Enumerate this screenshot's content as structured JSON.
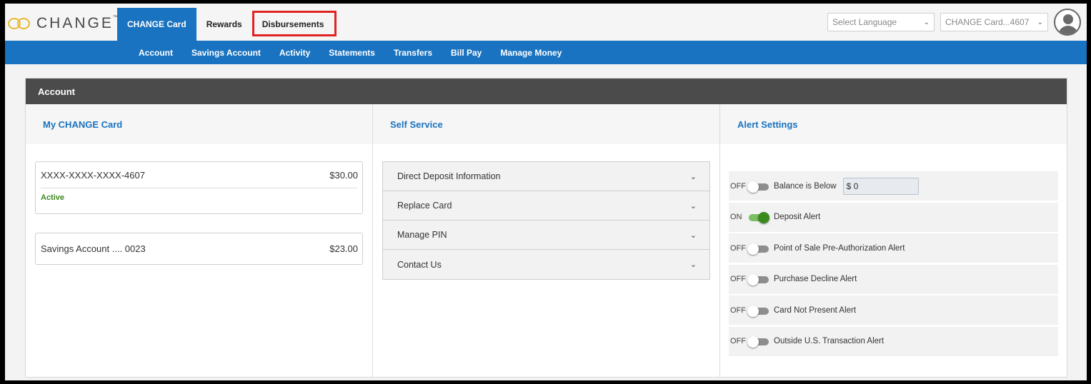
{
  "logo": {
    "text": "CHANGE",
    "tm": "™"
  },
  "main_tabs": [
    {
      "label": "CHANGE Card",
      "active": true
    },
    {
      "label": "Rewards",
      "active": false
    },
    {
      "label": "Disbursements",
      "active": false,
      "highlighted": true
    }
  ],
  "top_right": {
    "language_select": "Select Language",
    "card_select": "CHANGE Card...4607"
  },
  "subnav": [
    "Account",
    "Savings Account",
    "Activity",
    "Statements",
    "Transfers",
    "Bill Pay",
    "Manage Money"
  ],
  "panel": {
    "title": "Account",
    "my_card": {
      "heading": "My CHANGE Card",
      "accounts": [
        {
          "number": "XXXX-XXXX-XXXX-4607",
          "balance": "$30.00",
          "status": "Active"
        },
        {
          "number": "Savings Account .... 0023",
          "balance": "$23.00"
        }
      ]
    },
    "self_service": {
      "heading": "Self Service",
      "items": [
        "Direct Deposit Information",
        "Replace Card",
        "Manage PIN",
        "Contact Us"
      ]
    },
    "alert_settings": {
      "heading": "Alert Settings",
      "alerts": [
        {
          "state": "OFF",
          "on": false,
          "label": "Balance is Below",
          "amount": "$ 0"
        },
        {
          "state": "ON",
          "on": true,
          "label": "Deposit Alert"
        },
        {
          "state": "OFF",
          "on": false,
          "label": "Point of Sale Pre-Authorization Alert"
        },
        {
          "state": "OFF",
          "on": false,
          "label": "Purchase Decline Alert"
        },
        {
          "state": "OFF",
          "on": false,
          "label": "Card Not Present Alert"
        },
        {
          "state": "OFF",
          "on": false,
          "label": "Outside U.S. Transaction Alert"
        }
      ]
    }
  },
  "colors": {
    "brand_blue": "#1a73c0",
    "header_dark": "#4b4b4b",
    "active_green": "#3a8a1e",
    "highlight_red": "#e02424",
    "logo_gold": "#e8b830"
  },
  "icons": {
    "chevron": "chevron-down-icon",
    "avatar": "user-avatar-icon",
    "logo": "infinity-rings-icon"
  }
}
